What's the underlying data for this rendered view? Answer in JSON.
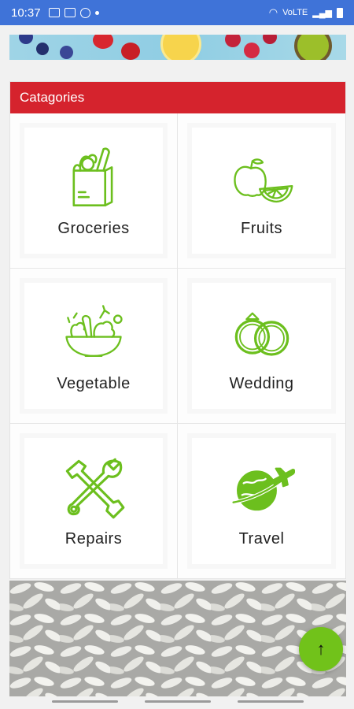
{
  "status_bar": {
    "time": "10:37",
    "icons": [
      "image-icon",
      "screen-icon",
      "message-icon",
      "dot-icon"
    ],
    "right_text": "VoLTE",
    "bg_color": "#3f73d8"
  },
  "categories": {
    "title": "Catagories",
    "header_color": "#d5232d",
    "icon_color": "#6cbf1e",
    "items": [
      {
        "label": "Groceries",
        "icon": "grocery-bag-icon"
      },
      {
        "label": "Fruits",
        "icon": "fruits-icon"
      },
      {
        "label": "Vegetable",
        "icon": "vegetable-bowl-icon"
      },
      {
        "label": "Wedding",
        "icon": "wedding-rings-icon"
      },
      {
        "label": "Repairs",
        "icon": "repair-tools-icon"
      },
      {
        "label": "Travel",
        "icon": "travel-globe-icon"
      }
    ]
  },
  "fab": {
    "label": "↑",
    "icon": "arrow-up-icon",
    "color": "#71c21a"
  }
}
